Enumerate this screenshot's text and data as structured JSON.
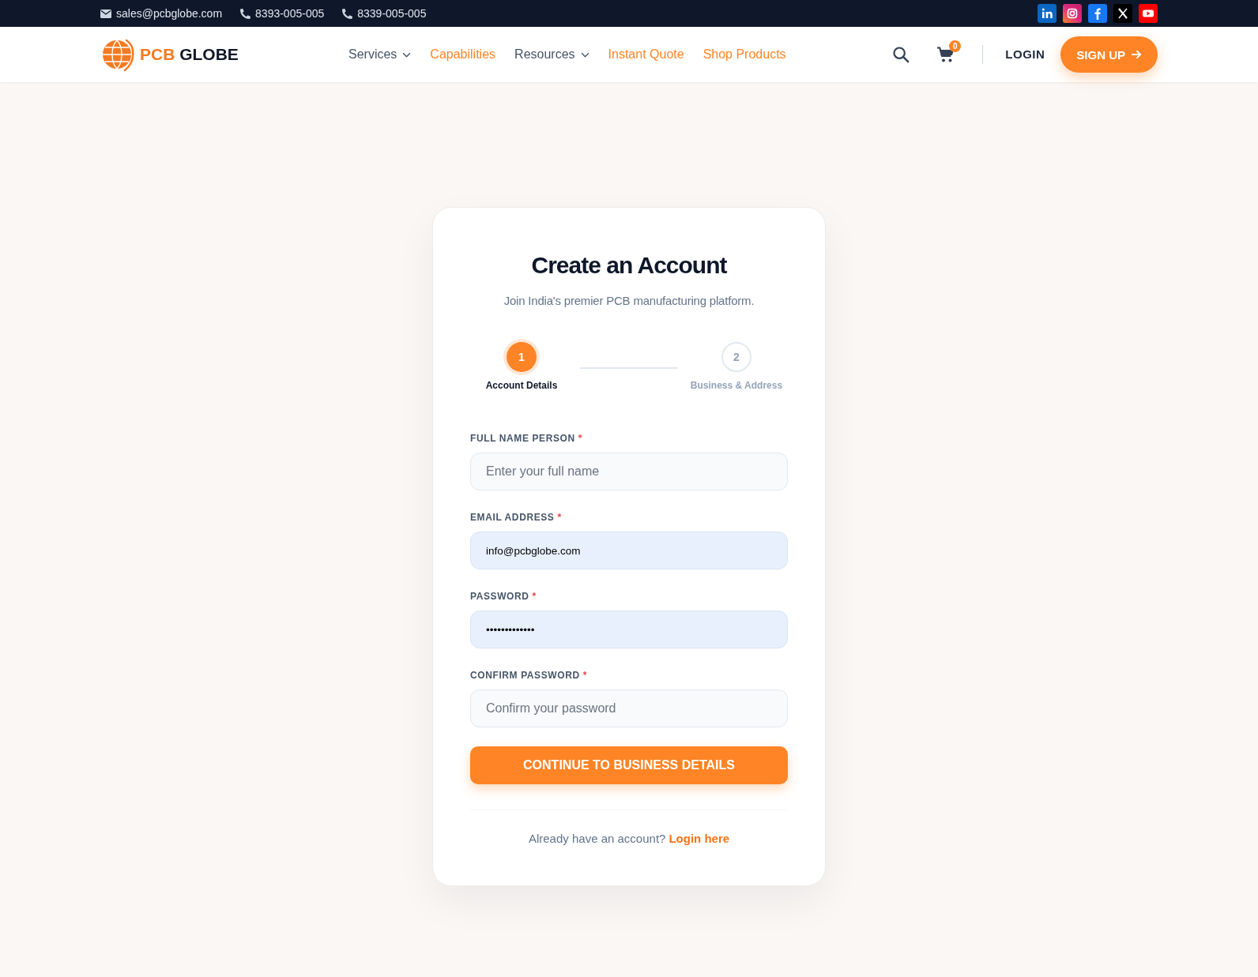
{
  "top_bar": {
    "contacts": [
      {
        "kind": "email",
        "text": "sales@pcbglobe.com"
      },
      {
        "kind": "phone",
        "text": "8393-005-005"
      },
      {
        "kind": "phone",
        "text": "8339-005-005"
      }
    ]
  },
  "header": {
    "logo": {
      "accent": "PCB",
      "text": "GLOBE"
    },
    "nav": [
      {
        "label": "Services",
        "kind": "menu"
      },
      {
        "label": "Capabilities",
        "kind": "link"
      },
      {
        "label": "Resources",
        "kind": "menu"
      },
      {
        "label": "Instant Quote",
        "kind": "link"
      },
      {
        "label": "Shop Products",
        "kind": "link"
      }
    ],
    "cart_count": "0",
    "login": "LOGIN",
    "signup": "SIGN UP"
  },
  "card": {
    "title": "Create an Account",
    "subtitle": "Join India's premier PCB manufacturing platform.",
    "steps": [
      {
        "number": "1",
        "label": "Account Details",
        "selected": true
      },
      {
        "number": "2",
        "label": "Business & Address",
        "selected": false
      }
    ],
    "fields": [
      {
        "label": "FULL NAME PERSON",
        "required_mark": "*",
        "placeholder": "Enter your full name",
        "autofilled": false
      },
      {
        "label": "EMAIL ADDRESS",
        "required_mark": "*",
        "value": "info@pcbglobe.com",
        "autofilled": true
      },
      {
        "label": "PASSWORD",
        "required_mark": "*",
        "value": "•••••••••••••",
        "autofilled": true
      },
      {
        "label": "CONFIRM PASSWORD",
        "required_mark": "*",
        "placeholder": "Confirm your password",
        "autofilled": false
      }
    ],
    "submit": "CONTINUE TO BUSINESS DETAILS",
    "footer": {
      "text": "Already have an account?",
      "link": "Login here"
    }
  }
}
